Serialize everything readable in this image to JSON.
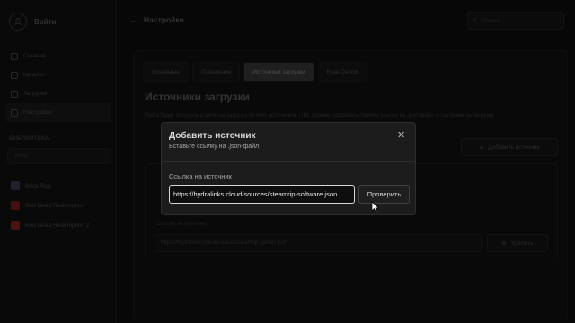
{
  "app": {
    "profile_name": "Войти"
  },
  "sidebar": {
    "items": [
      {
        "label": "Главная"
      },
      {
        "label": "Каталог"
      },
      {
        "label": "Загрузки"
      },
      {
        "label": "Настройки"
      }
    ],
    "library_header": "БИБЛИОТЕКА",
    "library_search_placeholder": "Поиск",
    "games": [
      {
        "label": "Brick Rigs",
        "color": "#3a3f52"
      },
      {
        "label": "Red Dead Redemption",
        "color": "#7a1c1c"
      },
      {
        "label": "Red Dead Redemption 2",
        "color": "#8a1f1f"
      }
    ]
  },
  "header": {
    "title": "Настройки",
    "search_placeholder": "Поиск"
  },
  "settings": {
    "tabs": [
      {
        "label": "Основные"
      },
      {
        "label": "Поведение"
      },
      {
        "label": "Источники загрузки"
      },
      {
        "label": "Real-Debrid"
      }
    ],
    "section_title": "Источники загрузки",
    "section_desc": "Hydra будет получать ссылки на загрузку из этих источников. URL должен содержать прямую ссылку на .json-файл с ссылками на загрузку.",
    "add_source_label": "Добавить источник",
    "source_url_label": "Ссылка на источник",
    "source_url_value": "https://hydralinks.cloud/sources/steamrip-games.json",
    "remove_label": "Удалить"
  },
  "modal": {
    "title": "Добавить источник",
    "subtitle": "Вставьте ссылку на .json-файл",
    "field_label": "Ссылка на источник",
    "url_value": "https://hydralinks.cloud/sources/steamrip-software.json",
    "verify_label": "Проверить"
  }
}
